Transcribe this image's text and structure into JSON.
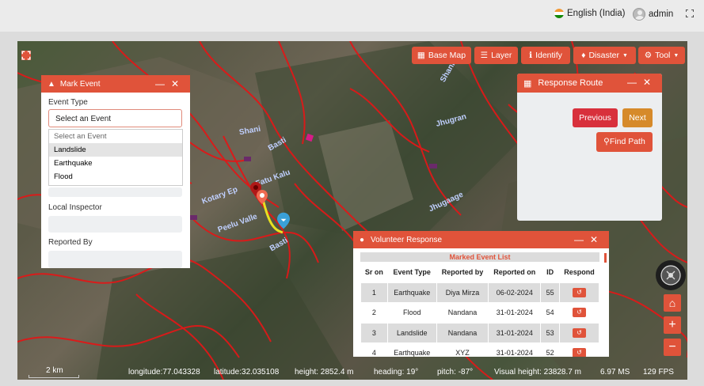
{
  "header": {
    "language": "English (India)",
    "user": "admin"
  },
  "toolbar": {
    "base_map": "Base Map",
    "layer": "Layer",
    "identify": "Identify",
    "disaster": "Disaster",
    "tool": "Tool"
  },
  "mark_event": {
    "title": "Mark Event",
    "event_type_label": "Event Type",
    "select_value": "Select an Event",
    "options": [
      "Select an Event",
      "Landslide",
      "Earthquake",
      "Flood"
    ],
    "local_inspector_label": "Local Inspector",
    "reported_by_label": "Reported By"
  },
  "response_route": {
    "title": "Response Route",
    "previous": "Previous",
    "next": "Next",
    "find_path": "Find Path"
  },
  "volunteer_response": {
    "title": "Volunteer Response",
    "list_title": "Marked Event List",
    "columns": [
      "Sr on",
      "Event Type",
      "Reported by",
      "Reported on",
      "ID",
      "Respond"
    ],
    "rows": [
      [
        "1",
        "Earthquake",
        "Diya Mirza",
        "06-02-2024",
        "55"
      ],
      [
        "2",
        "Flood",
        "Nandana",
        "31-01-2024",
        "54"
      ],
      [
        "3",
        "Landslide",
        "Nandana",
        "31-01-2024",
        "53"
      ],
      [
        "4",
        "Earthquake",
        "XYZ",
        "31-01-2024",
        "52"
      ]
    ]
  },
  "map_labels": [
    "Shani",
    "Jhugran",
    "Basti",
    "Shani",
    "Fatu Kalu",
    "Kotary Ep",
    "Peelu Valle",
    "Basti",
    "Jhugaage"
  ],
  "status_bar": {
    "scale": "2 km",
    "longitude": "longitude:77.043328",
    "latitude": "latitude:32.035108",
    "height": "height: 2852.4 m",
    "heading": "heading: 19°",
    "pitch": "pitch: -87°",
    "visual_height": "Visual height: 23828.7 m",
    "ms": "6.97 MS",
    "fps": "129 FPS"
  },
  "colors": {
    "accent": "#e0533a",
    "route": "#e8e020",
    "road": "#e01818",
    "marker_blue": "#3aa0d8",
    "next_button": "#d68a2a",
    "prev_button": "#d8303c"
  }
}
